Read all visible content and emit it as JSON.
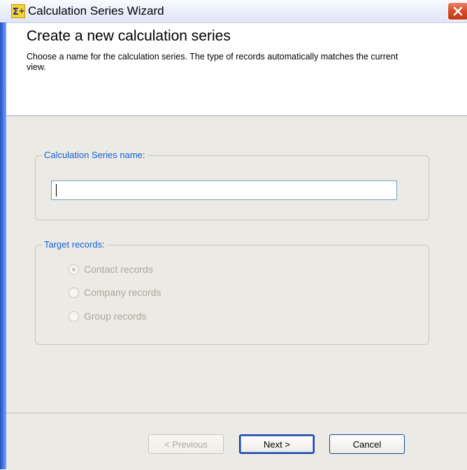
{
  "window": {
    "title": "Calculation Series Wizard",
    "icon": "sigma-plus-icon"
  },
  "header": {
    "title": "Create a new calculation series",
    "description": "Choose a name for the calculation series. The type of records automatically matches the current view."
  },
  "name_group": {
    "legend": "Calculation Series name:",
    "input_value": ""
  },
  "target_group": {
    "legend": "Target records:",
    "options": [
      {
        "label": "Contact records",
        "checked": true
      },
      {
        "label": "Company records",
        "checked": false
      },
      {
        "label": "Group records",
        "checked": false
      }
    ]
  },
  "buttons": {
    "previous": "< Previous",
    "next": "Next >",
    "cancel": "Cancel"
  },
  "colors": {
    "legend": "#1560d8",
    "disabled_text": "#aca899",
    "body_bg": "#ebeae4"
  }
}
